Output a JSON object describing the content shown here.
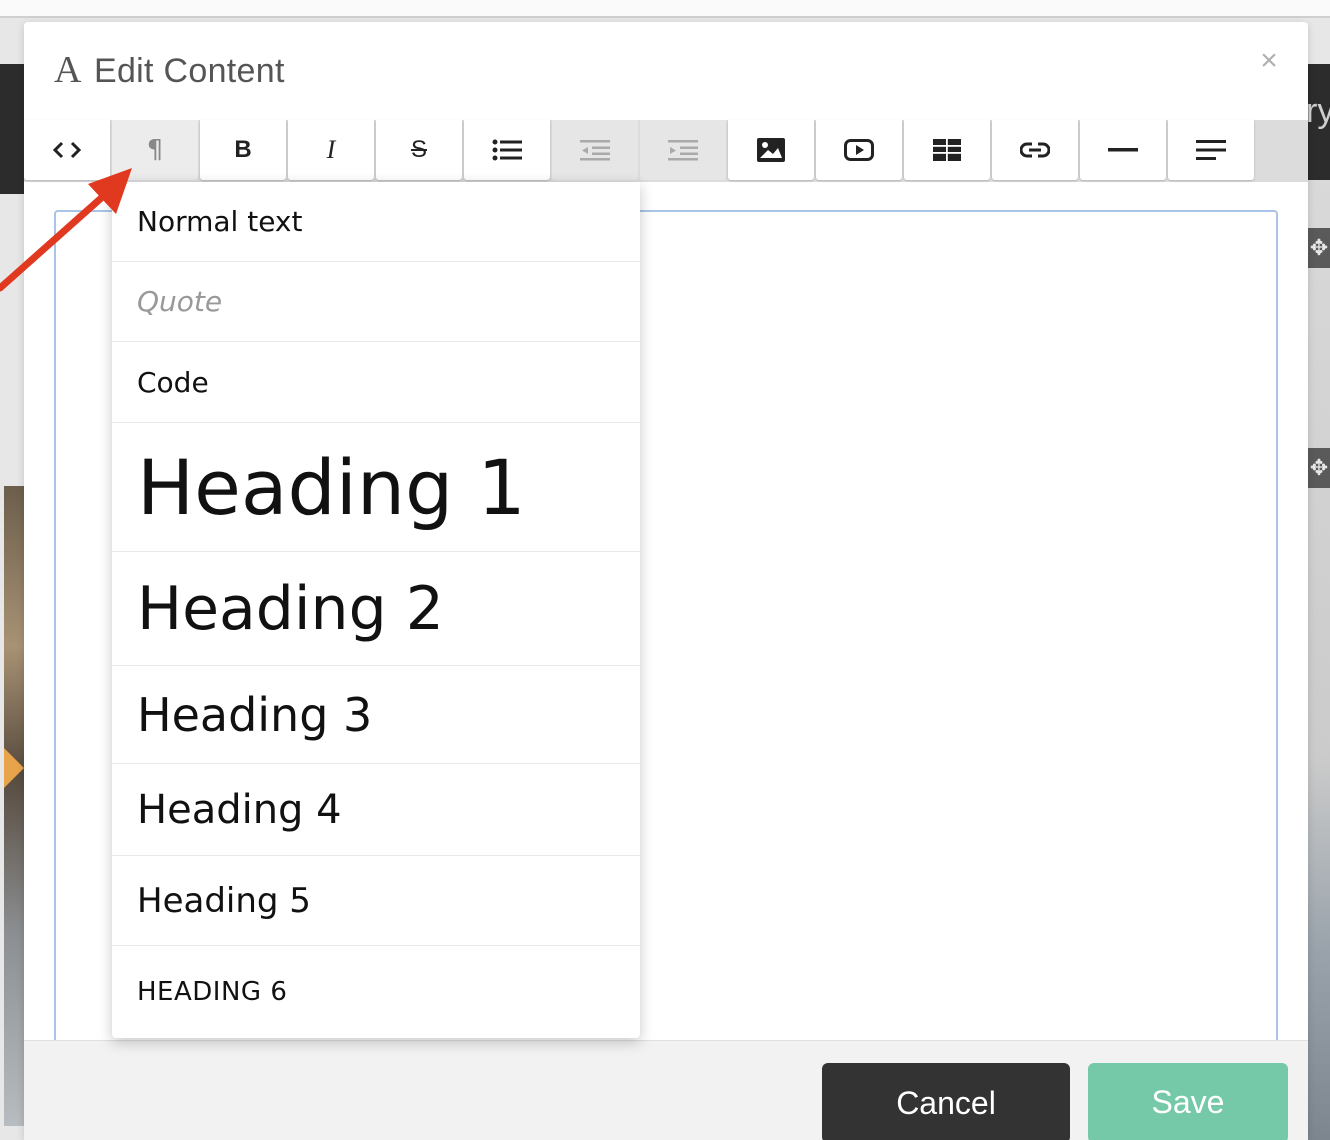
{
  "modal": {
    "title_icon": "A",
    "title": "Edit Content",
    "close_label": "×"
  },
  "toolbar": {
    "buttons": [
      {
        "name": "html-source-button",
        "icon": "code-icon",
        "glyph": "<>",
        "state": "normal"
      },
      {
        "name": "format-button",
        "icon": "paragraph-icon",
        "glyph": "¶",
        "state": "active"
      },
      {
        "name": "bold-button",
        "icon": "bold-icon",
        "glyph": "B",
        "state": "normal"
      },
      {
        "name": "italic-button",
        "icon": "italic-icon",
        "glyph": "I",
        "state": "normal"
      },
      {
        "name": "strikethrough-button",
        "icon": "strikethrough-icon",
        "glyph": "S",
        "state": "normal"
      },
      {
        "name": "unordered-list-button",
        "icon": "list-icon",
        "state": "normal"
      },
      {
        "name": "outdent-button",
        "icon": "outdent-icon",
        "state": "disabled"
      },
      {
        "name": "indent-button",
        "icon": "indent-icon",
        "state": "disabled"
      },
      {
        "name": "image-button",
        "icon": "image-icon",
        "state": "normal"
      },
      {
        "name": "video-button",
        "icon": "video-icon",
        "state": "normal"
      },
      {
        "name": "table-button",
        "icon": "table-icon",
        "state": "normal"
      },
      {
        "name": "link-button",
        "icon": "link-icon",
        "state": "normal"
      },
      {
        "name": "horizontal-rule-button",
        "icon": "horizontal-rule-icon",
        "state": "normal"
      },
      {
        "name": "alignment-button",
        "icon": "align-left-icon",
        "state": "normal"
      }
    ]
  },
  "dropdown": {
    "items": [
      {
        "label": "Normal text"
      },
      {
        "label": "Quote"
      },
      {
        "label": "Code"
      },
      {
        "label": "Heading 1"
      },
      {
        "label": "Heading 2"
      },
      {
        "label": "Heading 3"
      },
      {
        "label": "Heading 4"
      },
      {
        "label": "Heading 5"
      },
      {
        "label": "HEADING 6"
      }
    ]
  },
  "footer": {
    "cancel_label": "Cancel",
    "save_label": "Save"
  },
  "background": {
    "partial_text": "ry",
    "move_handle_glyph": "✥"
  },
  "colors": {
    "save_green": "#76c9a8",
    "cancel_dark": "#333333",
    "arrow_red": "#e0391f",
    "editor_border": "#aac4e6"
  }
}
